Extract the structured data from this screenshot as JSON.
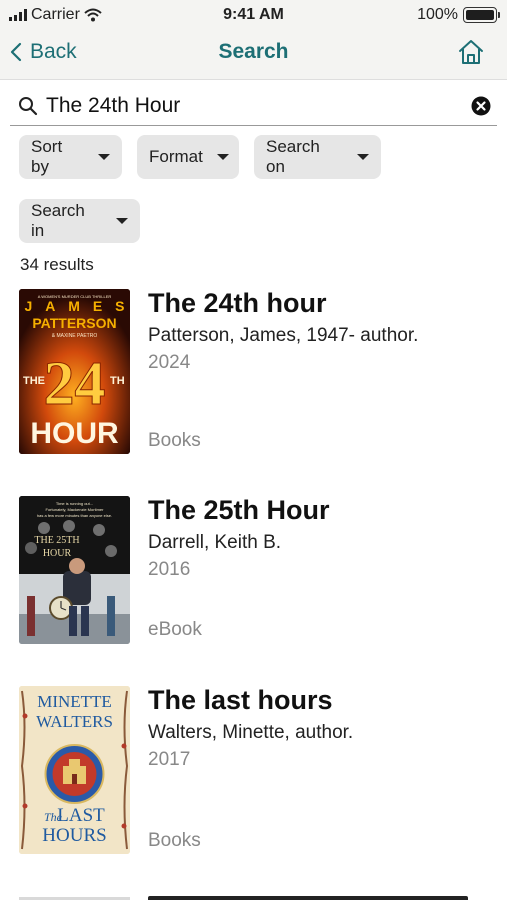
{
  "status_bar": {
    "carrier": "Carrier",
    "time": "9:41 AM",
    "battery": "100%",
    "battery_level": 1.0
  },
  "nav": {
    "back_label": "Back",
    "title": "Search",
    "home_icon": "home-icon",
    "accent_color": "#1d6f75"
  },
  "search": {
    "value": "The 24th Hour",
    "placeholder": ""
  },
  "filters": {
    "sort_by": "Sort by",
    "format": "Format",
    "search_on": "Search on",
    "search_in": "Search in"
  },
  "results_count": "34 results",
  "results": [
    {
      "title": "The 24th hour",
      "author": "Patterson, James, 1947- author.",
      "year": "2024",
      "format": "Books",
      "cover_text": {
        "series": "A WOMEN'S MURDER CLUB THRILLER",
        "author": "JAMES PATTERSON",
        "coauthor": "& MAXINE PAETRO",
        "title_a": "THE",
        "number": "24",
        "suffix": "TH",
        "title_b": "HOUR"
      }
    },
    {
      "title": "The 25th Hour",
      "author": "Darrell, Keith B.",
      "year": "2016",
      "format": "eBook",
      "cover_text": {
        "tagline": "Time is running out... Fortunately, Mackenzie Mortimer has a few more minutes than anyone else.",
        "title": "THE 25TH HOUR"
      }
    },
    {
      "title": "The last hours",
      "author": "Walters, Minette, author.",
      "year": "2017",
      "format": "Books",
      "cover_text": {
        "author_a": "MINETTE",
        "author_b": "WALTERS",
        "title_a": "The",
        "title_b": "LAST",
        "title_c": "HOURS"
      }
    }
  ]
}
